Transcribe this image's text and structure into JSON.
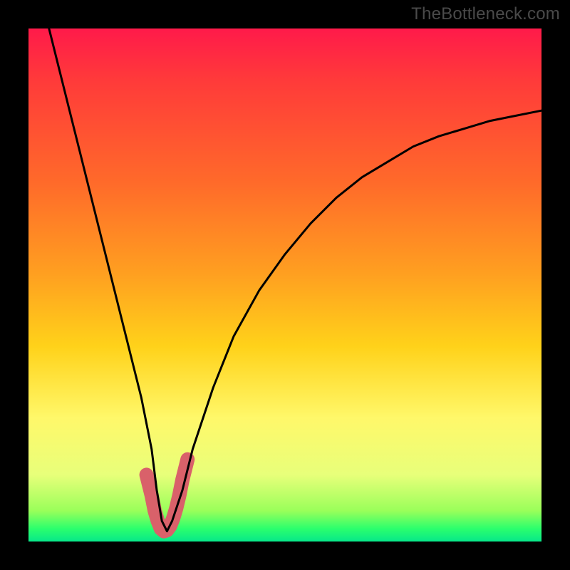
{
  "watermark": {
    "text": "TheBottleneck.com"
  },
  "chart_data": {
    "type": "line",
    "title": "",
    "xlabel": "",
    "ylabel": "",
    "xlim": [
      0,
      100
    ],
    "ylim": [
      0,
      100
    ],
    "series": [
      {
        "name": "bottleneck-curve",
        "x": [
          4,
          6,
          8,
          10,
          12,
          14,
          16,
          18,
          20,
          22,
          24,
          25,
          26,
          27,
          28,
          30,
          32,
          36,
          40,
          45,
          50,
          55,
          60,
          65,
          70,
          75,
          80,
          85,
          90,
          95,
          100
        ],
        "values": [
          100,
          92,
          84,
          76,
          68,
          60,
          52,
          44,
          36,
          28,
          18,
          10,
          4,
          2,
          4,
          10,
          18,
          30,
          40,
          49,
          56,
          62,
          67,
          71,
          74,
          77,
          79,
          80.5,
          82,
          83,
          84
        ]
      }
    ],
    "highlight": {
      "name": "trough-highlight",
      "x": [
        23,
        24,
        24.6,
        25.2,
        25.8,
        26.4,
        27,
        27.6,
        28.2,
        28.8,
        29.4,
        30,
        31
      ],
      "values": [
        13,
        9,
        6,
        4,
        2.5,
        2,
        2.2,
        3,
        4.5,
        6.5,
        9,
        12,
        16
      ],
      "color": "#d9616a",
      "stroke_width_px": 20
    },
    "colors": {
      "curve": "#000000",
      "highlight": "#d9616a",
      "background_top": "#ff1a4a",
      "background_bottom": "#07e88a",
      "frame": "#000000"
    }
  }
}
